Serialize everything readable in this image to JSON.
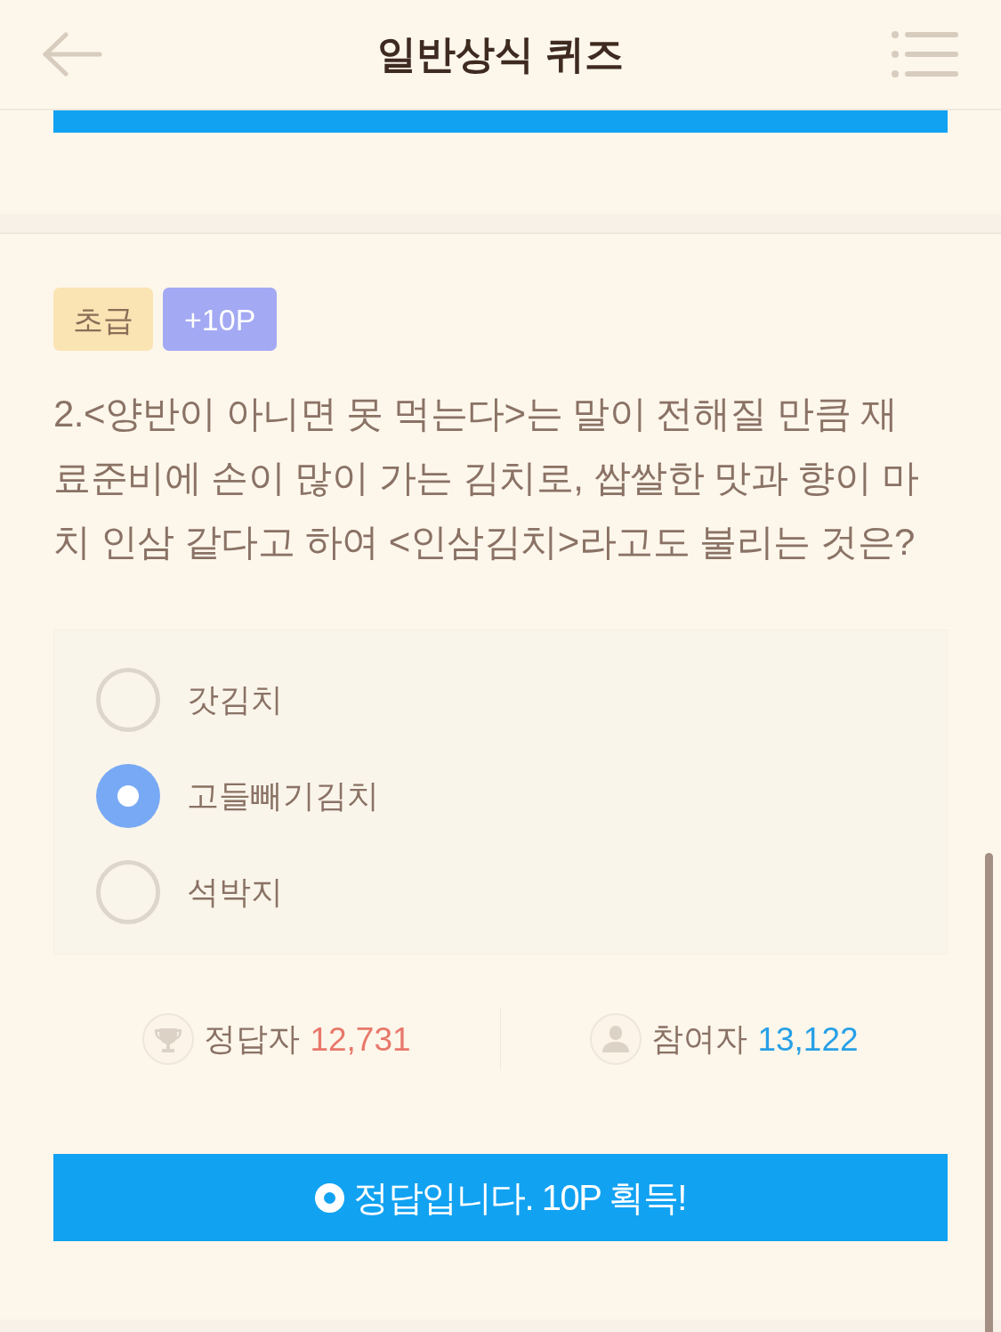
{
  "header": {
    "title": "일반상식 퀴즈"
  },
  "quiz": {
    "badges": [
      {
        "kind": "level",
        "label": "초급"
      },
      {
        "kind": "points",
        "label": "+10P"
      }
    ],
    "question": "2.<양반이 아니면 못 먹는다>는 말이 전해질 만큼 재료준비에 손이 많이 가는 김치로, 쌉쌀한 맛과 향이 마치 인삼 같다고 하여 <인삼김치>라고도 불리는 것은?",
    "options": [
      {
        "label": "갓김치",
        "selected": false
      },
      {
        "label": "고들빼기김치",
        "selected": true
      },
      {
        "label": "석박지",
        "selected": false
      }
    ],
    "stats": [
      {
        "kind": "correct",
        "label": "정답자",
        "count": "12,731"
      },
      {
        "kind": "participants",
        "label": "참여자",
        "count": "13,122"
      }
    ],
    "result": {
      "message": "정답입니다. 10P 획득!"
    }
  }
}
